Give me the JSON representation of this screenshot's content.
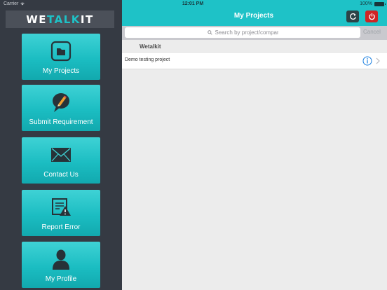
{
  "status_bar": {
    "carrier": "Carrier",
    "time": "12:01 PM",
    "battery": "100%"
  },
  "logo": {
    "part1": "WE",
    "part2": "TALK",
    "part3": "IT"
  },
  "sidebar": {
    "items": [
      {
        "label": "My Projects",
        "icon": "folder-icon"
      },
      {
        "label": "Submit Requirement",
        "icon": "chat-pencil-icon"
      },
      {
        "label": "Contact Us",
        "icon": "envelope-icon"
      },
      {
        "label": "Report Error",
        "icon": "document-warning-icon"
      },
      {
        "label": "My  Profile",
        "icon": "user-icon"
      }
    ]
  },
  "header": {
    "title": "My Projects",
    "refresh_icon": "refresh-icon",
    "power_icon": "power-icon"
  },
  "search": {
    "placeholder": "Search by project/company",
    "cancel": "Cancel"
  },
  "list": {
    "section": "Wetalkit",
    "rows": [
      {
        "title": "Demo testing project"
      }
    ]
  },
  "colors": {
    "accent": "#1ec2c7",
    "sidebar": "#353a43",
    "power": "#d02424"
  }
}
